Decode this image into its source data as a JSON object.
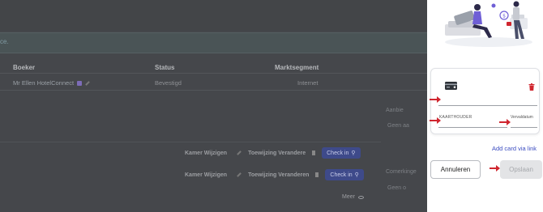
{
  "background": {
    "info_text": "ce.",
    "table": {
      "headers": [
        "Boeker",
        "Status",
        "Marktsegment"
      ],
      "row": {
        "booker": "Mr Ellen HotelConnect",
        "status": "Bevestigd",
        "segment": "Internet"
      }
    },
    "side_labels": [
      "Aanbie",
      "Geen aa",
      "Comerkinge",
      "Geen o"
    ],
    "actions": [
      {
        "room_label": "Kamer Wijzigen",
        "assign_label": "Toewijzing Verandere",
        "checkin_label": "Check in"
      },
      {
        "room_label": "Kamer Wijzigen",
        "assign_label": "Toewijzing Veranderen",
        "checkin_label": "Check in"
      }
    ],
    "more_label": "Meer"
  },
  "drawer": {
    "card": {
      "holder_label": "KAARTHOUDER",
      "expiry_label": "Vervaldatum"
    },
    "add_card_link": "Add card via link",
    "cancel_button": "Annuleren",
    "save_button": "Opslaan"
  },
  "colors": {
    "accent": "#3b4cc0",
    "danger": "#d0262f",
    "arrow": "#d0262f"
  }
}
